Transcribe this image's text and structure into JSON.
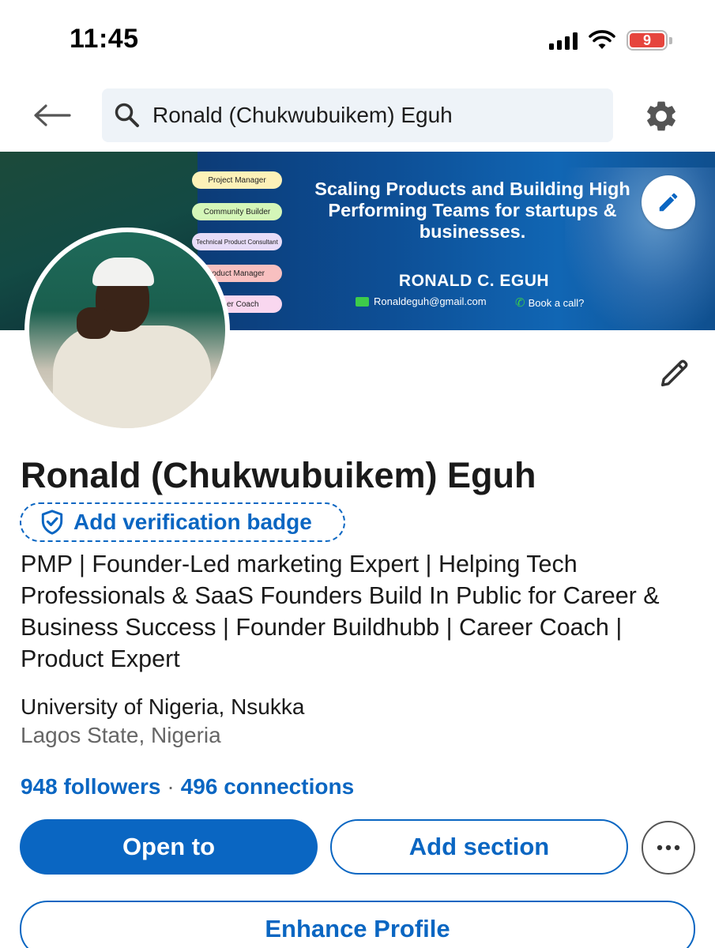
{
  "status_bar": {
    "time": "11:45",
    "battery_level": "9",
    "icons": [
      "signal-icon",
      "wifi-icon",
      "battery-icon"
    ]
  },
  "nav": {
    "back_icon": "arrow-left-icon",
    "search_query": "Ronald (Chukwubuikem) Eguh",
    "search_icon": "search-icon",
    "settings_icon": "gear-icon"
  },
  "banner": {
    "pills": [
      "Project Manager",
      "Community Builder",
      "Technical Product Consultant",
      "roduct Manager",
      "areer Coach"
    ],
    "headline": "Scaling Products and Building High Performing Teams for startups & businesses.",
    "name": "RONALD C. EGUH",
    "email": "Ronaldeguh@gmail.com",
    "call": "Book a call?"
  },
  "profile": {
    "name": "Ronald (Chukwubuikem) Eguh",
    "verification_label": "Add verification badge",
    "headline": "PMP | Founder-Led marketing Expert | Helping Tech Professionals & SaaS Founders Build In Public for Career & Business Success | Founder Buildhubb | Career Coach | Product Expert",
    "education": "University of Nigeria, Nsukka",
    "location": "Lagos State, Nigeria",
    "followers": "948 followers",
    "separator": "·",
    "connections": "496 connections"
  },
  "actions": {
    "open_to": "Open to",
    "add_section": "Add section",
    "more": "•••",
    "enhance": "Enhance Profile"
  },
  "colors": {
    "accent": "#0a66c2",
    "search_bg": "#eef3f8",
    "battery_red": "#e6453d"
  }
}
